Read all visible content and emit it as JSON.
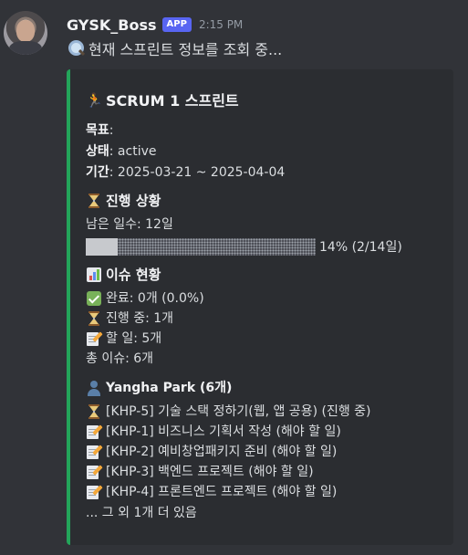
{
  "author": {
    "username": "GYSK_Boss",
    "badge": "APP",
    "timestamp": "2:15 PM"
  },
  "message": {
    "icon": "magnifying-glass-icon",
    "text": "현재 스프린트 정보를 조회 중..."
  },
  "embed": {
    "accent_color": "#23a55a",
    "title": "SCRUM 1 스프린트",
    "goal_label": "목표",
    "goal_value": ":",
    "status_label": "상태",
    "status_value": ": active",
    "period_label": "기간",
    "period_value": ": 2025-03-21 ~ 2025-04-04",
    "progress_section": {
      "title": "진행 상황",
      "days_left": "남은 일수: 12일",
      "progress_fraction": 0.14,
      "progress_text": "14% (2/14일)"
    },
    "issues_section": {
      "title": "이슈 현황",
      "done": "완료: 0개 (0.0%)",
      "in_progress": "진행 중: 1개",
      "todo": "할 일: 5개",
      "total": "총 이슈: 6개"
    },
    "assignee_section": {
      "title": "Yangha Park (6개)",
      "items": [
        {
          "icon": "hourglass-icon",
          "text": "[KHP-5] 기술 스택 정하기(웹, 앱 공용) (진행 중)"
        },
        {
          "icon": "memo-icon",
          "text": "[KHP-1] 비즈니스 기획서 작성 (해야 할 일)"
        },
        {
          "icon": "memo-icon",
          "text": "[KHP-2] 예비창업패키지 준비 (해야 할 일)"
        },
        {
          "icon": "memo-icon",
          "text": "[KHP-3] 백엔드 프로젝트 (해야 할 일)"
        },
        {
          "icon": "memo-icon",
          "text": "[KHP-4] 프론트엔드 프로젝트 (해야 할 일)"
        }
      ],
      "more": "... 그 외 1개 더 있음"
    }
  }
}
